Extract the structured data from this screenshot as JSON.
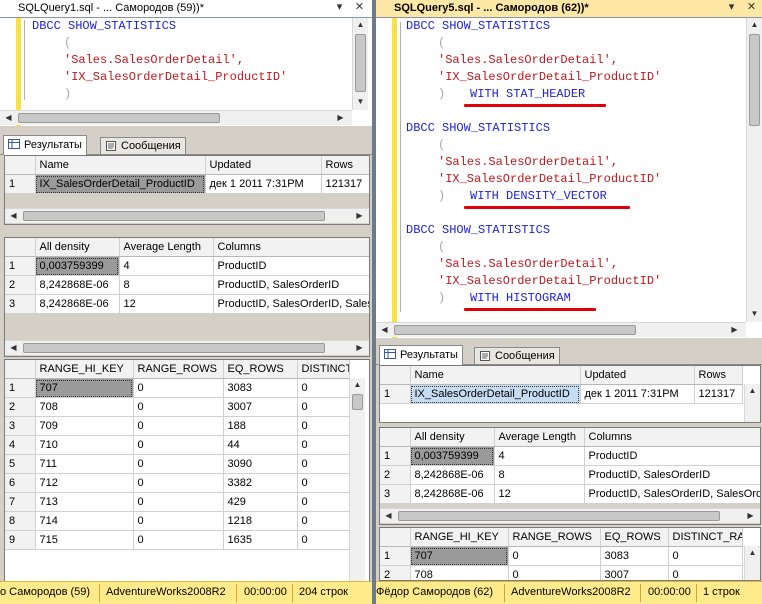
{
  "left": {
    "tab_title": "SQLQuery1.sql - ... Самородов (59))*",
    "code": {
      "kw1": "DBCC SHOW_STATISTICS",
      "open": "(",
      "s1": "'Sales.SalesOrderDetail',",
      "s2": "'IX_SalesOrderDetail_ProductID'",
      "close": ")"
    },
    "results_tab": "Результаты",
    "messages_tab": "Сообщения",
    "header_grid": {
      "columns": [
        "Name",
        "Updated",
        "Rows"
      ],
      "rows": [
        [
          "1",
          "IX_SalesOrderDetail_ProductID",
          "дек  1 2011  7:31PM",
          "121317"
        ]
      ]
    },
    "density_grid": {
      "columns": [
        "All density",
        "Average Length",
        "Columns"
      ],
      "rows": [
        [
          "1",
          "0,003759399",
          "4",
          "ProductID"
        ],
        [
          "2",
          "8,242868E-06",
          "8",
          "ProductID, SalesOrderID"
        ],
        [
          "3",
          "8,242868E-06",
          "12",
          "ProductID, SalesOrderID, SalesOrderDetailID"
        ]
      ]
    },
    "histogram_grid": {
      "columns": [
        "RANGE_HI_KEY",
        "RANGE_ROWS",
        "EQ_ROWS",
        "DISTINCT_RANGE_ROWS"
      ],
      "rows": [
        [
          "1",
          "707",
          "0",
          "3083",
          "0"
        ],
        [
          "2",
          "708",
          "0",
          "3007",
          "0"
        ],
        [
          "3",
          "709",
          "0",
          "188",
          "0"
        ],
        [
          "4",
          "710",
          "0",
          "44",
          "0"
        ],
        [
          "5",
          "711",
          "0",
          "3090",
          "0"
        ],
        [
          "6",
          "712",
          "0",
          "3382",
          "0"
        ],
        [
          "7",
          "713",
          "0",
          "429",
          "0"
        ],
        [
          "8",
          "714",
          "0",
          "1218",
          "0"
        ],
        [
          "9",
          "715",
          "0",
          "1635",
          "0"
        ]
      ]
    },
    "status": {
      "user": "о Самородов (59)",
      "db": "AdventureWorks2008R2",
      "time": "00:00:00",
      "rows": "204 строк"
    }
  },
  "right": {
    "tab_title": "SQLQuery5.sql - ... Самородов (62))*",
    "code": {
      "kw1": "DBCC SHOW_STATISTICS",
      "open": "(",
      "s1": "'Sales.SalesOrderDetail',",
      "s2": "'IX_SalesOrderDetail_ProductID'",
      "close": ")",
      "with1": "WITH STAT_HEADER",
      "with2": "WITH DENSITY_VECTOR",
      "with3": "WITH HISTOGRAM"
    },
    "results_tab": "Результаты",
    "messages_tab": "Сообщения",
    "header_grid": {
      "columns": [
        "Name",
        "Updated",
        "Rows"
      ],
      "rows": [
        [
          "1",
          "IX_SalesOrderDetail_ProductID",
          "дек  1 2011  7:31PM",
          "121317"
        ]
      ]
    },
    "density_grid": {
      "columns": [
        "All density",
        "Average Length",
        "Columns"
      ],
      "rows": [
        [
          "1",
          "0,003759399",
          "4",
          "ProductID"
        ],
        [
          "2",
          "8,242868E-06",
          "8",
          "ProductID, SalesOrderID"
        ],
        [
          "3",
          "8,242868E-06",
          "12",
          "ProductID, SalesOrderID, SalesOrderDetailID"
        ]
      ]
    },
    "histogram_grid": {
      "columns": [
        "RANGE_HI_KEY",
        "RANGE_ROWS",
        "EQ_ROWS",
        "DISTINCT_RANGE_ROWS"
      ],
      "rows": [
        [
          "1",
          "707",
          "0",
          "3083",
          "0"
        ],
        [
          "2",
          "708",
          "0",
          "3007",
          "0"
        ]
      ]
    },
    "status": {
      "user": "Фёдор Самородов (62)",
      "db": "AdventureWorks2008R2",
      "time": "00:00:00",
      "rows": "1 строк"
    }
  },
  "colors": {
    "keyword": "#1f1fd6",
    "string": "#c0161e",
    "underline": "#e0000a",
    "status_bg": "#ffeb8a",
    "active_tab_bg": "#ffe8a6"
  },
  "icons": {
    "pin": "pin-icon",
    "close": "close-icon",
    "grid": "grid-icon",
    "messages": "messages-icon"
  }
}
